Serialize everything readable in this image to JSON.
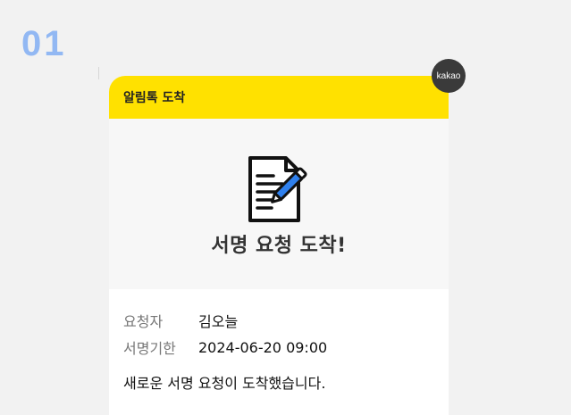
{
  "step": {
    "number": "01"
  },
  "badge": {
    "label": "kakao"
  },
  "card": {
    "header_title": "알림톡 도착",
    "hero_title": "서명 요청 도착!",
    "hero_icon": "document-sign-icon",
    "fields": [
      {
        "label": "요청자",
        "value": "김오늘"
      },
      {
        "label": "서명기한",
        "value": "2024-06-20 09:00"
      }
    ],
    "message": "새로운 서명 요청이 도착했습니다."
  },
  "colors": {
    "header_bg": "#ffe100",
    "step_number": "#92b8f3",
    "icon_accent": "#2f80ed",
    "badge_bg": "#3a3a3a"
  }
}
